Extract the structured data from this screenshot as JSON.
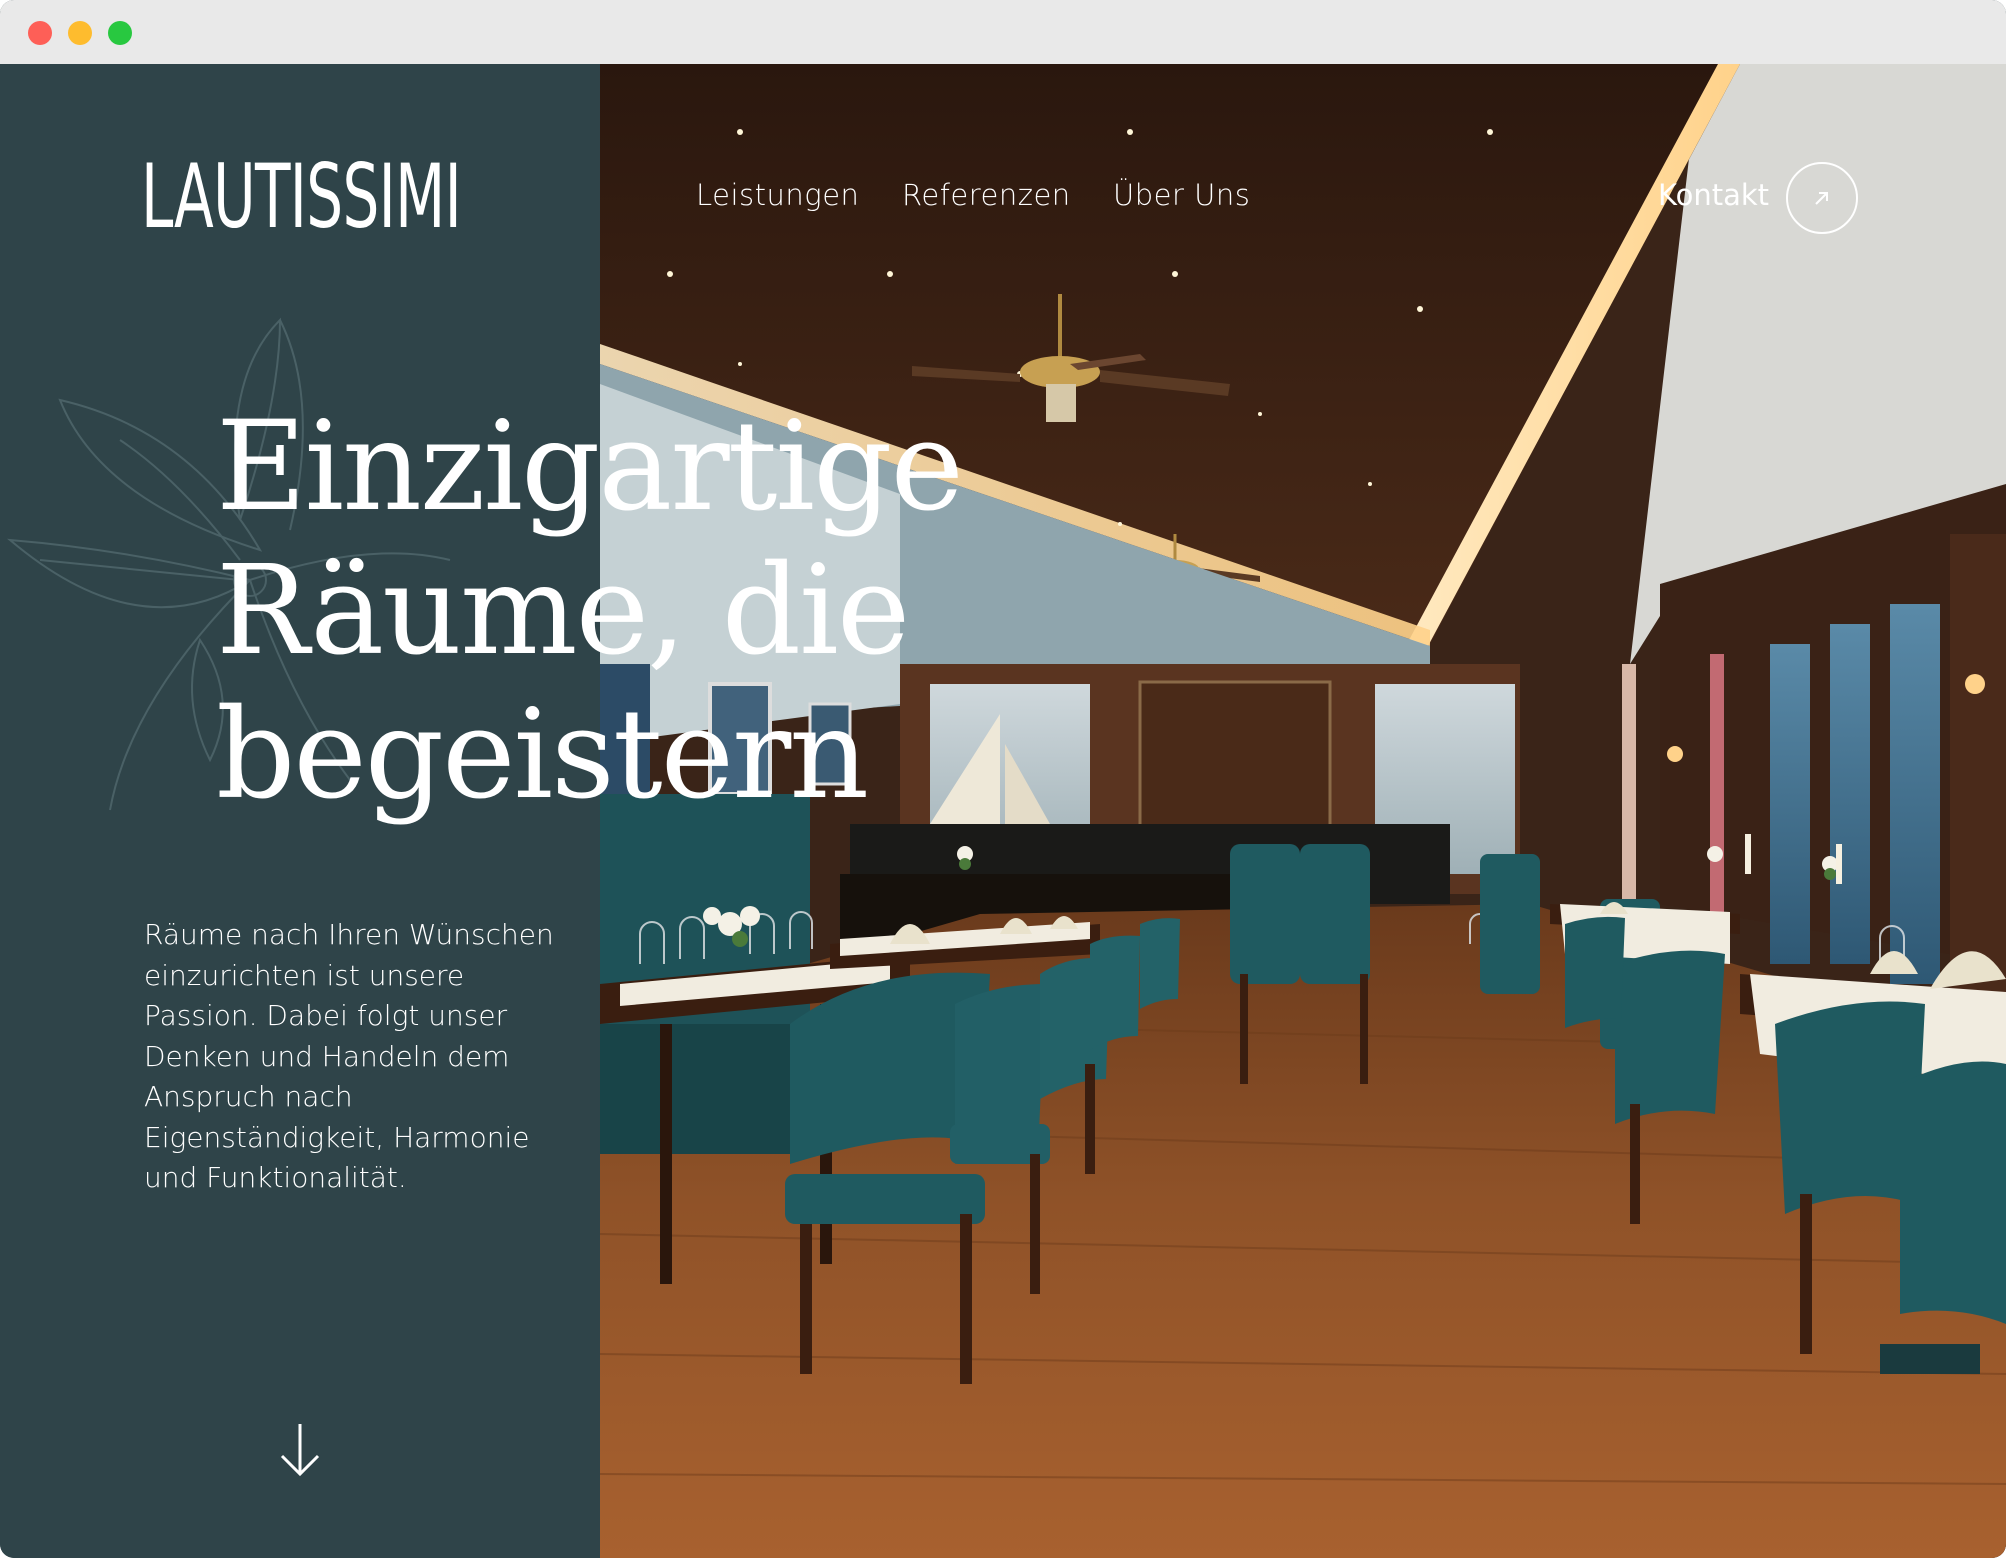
{
  "brand": {
    "logo_text": "LAUTISSIMI"
  },
  "nav": {
    "items": [
      "Leistungen",
      "Referenzen",
      "Über Uns"
    ],
    "contact_label": "Kontakt",
    "contact_icon": "arrow-up-right-icon"
  },
  "hero": {
    "headline_lines": [
      "Einzigartige",
      "Räume, die",
      "begeistern"
    ],
    "lead": "Räume nach Ihren Wünschen einzurichten ist unsere Passion. Dabei folgt unser Denken und Handeln dem Anspruch nach Eigenständigkeit, Harmonie und Funktionalität.",
    "scroll_icon": "arrow-down-icon",
    "photo_alt": "restaurant-interior-photo"
  },
  "colors": {
    "sidebar": "#2f4449",
    "text": "#ffffff",
    "chair_teal": "#1f5a60",
    "floor_wood": "#8a4e25"
  }
}
